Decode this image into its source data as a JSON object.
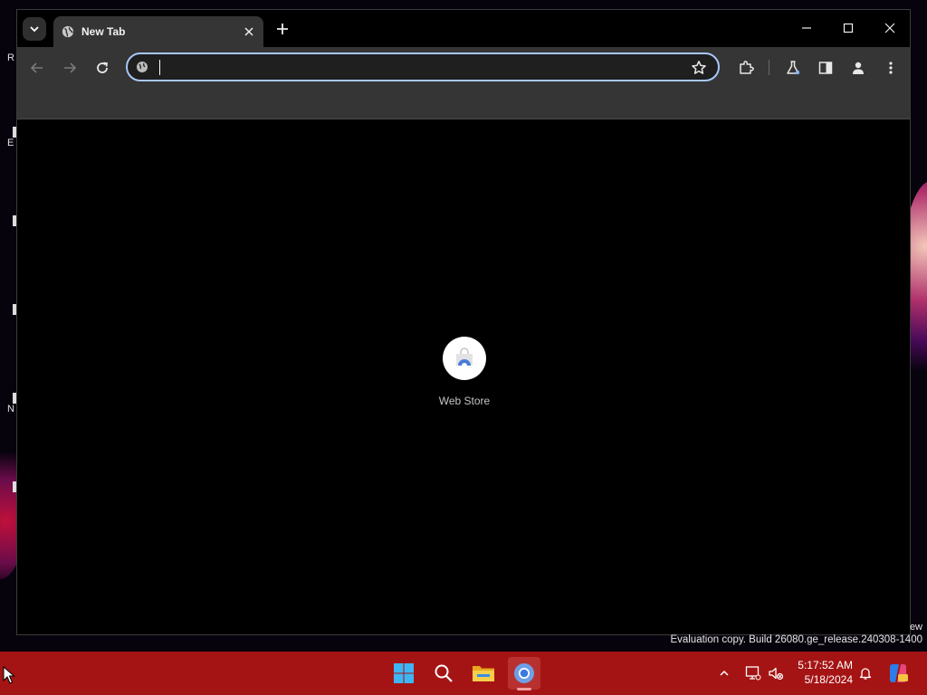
{
  "browser": {
    "tab": {
      "title": "New Tab"
    },
    "omnibox": {
      "value": "",
      "placeholder": ""
    },
    "shortcuts": [
      {
        "label": "Web Store"
      }
    ]
  },
  "desktop": {
    "icon_letters": [
      "R",
      "E",
      "N"
    ],
    "watermark_line1": "ew",
    "watermark_line2": "Evaluation copy. Build 26080.ge_release.240308-1400"
  },
  "taskbar": {
    "time": "5:17:52 AM",
    "date": "5/18/2024",
    "color": "#a51414"
  },
  "colors": {
    "accent": "#a8c7fa",
    "toolbar": "#353535"
  }
}
